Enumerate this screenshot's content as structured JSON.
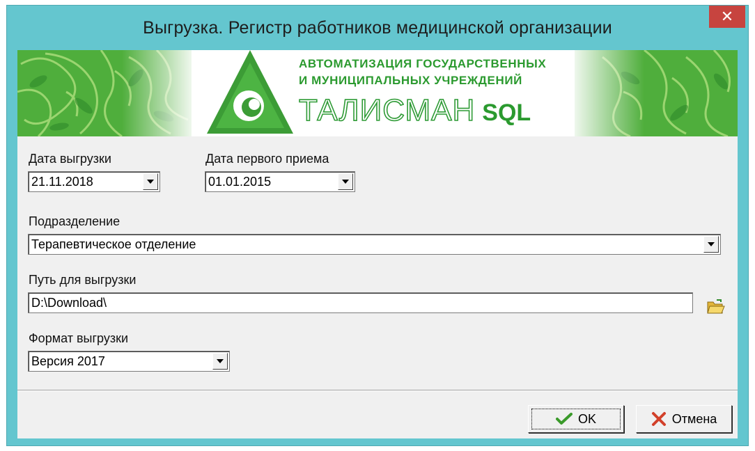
{
  "window": {
    "title": "Выгрузка. Регистр работников медицинской организации",
    "close_symbol": "✕"
  },
  "banner": {
    "line1": "АВТОМАТИЗАЦИЯ ГОСУДАРСТВЕННЫХ",
    "line2": "И МУНИЦИПАЛЬНЫХ УЧРЕЖДЕНИЙ",
    "brand_name": "ТАЛИСМАН",
    "brand_suffix": "SQL",
    "logo_icon": "talisman-triangle-logo-icon"
  },
  "form": {
    "export_date": {
      "label": "Дата выгрузки",
      "value": "21.11.2018"
    },
    "first_admission_date": {
      "label": "Дата первого приема",
      "value": "01.01.2015"
    },
    "department": {
      "label": "Подразделение",
      "value": "Терапевтическое отделение"
    },
    "export_path": {
      "label": "Путь для выгрузки",
      "value": "D:\\Download\\",
      "browse_icon": "folder-open-icon"
    },
    "export_format": {
      "label": "Формат выгрузки",
      "value": "Версия 2017"
    }
  },
  "buttons": {
    "ok": {
      "label": "OK",
      "icon": "checkmark-icon"
    },
    "cancel": {
      "label": "Отмена",
      "icon": "cross-icon"
    }
  },
  "colors": {
    "window_frame": "#64c6cf",
    "close_button": "#c7443f",
    "brand_green": "#2b9a2f"
  }
}
